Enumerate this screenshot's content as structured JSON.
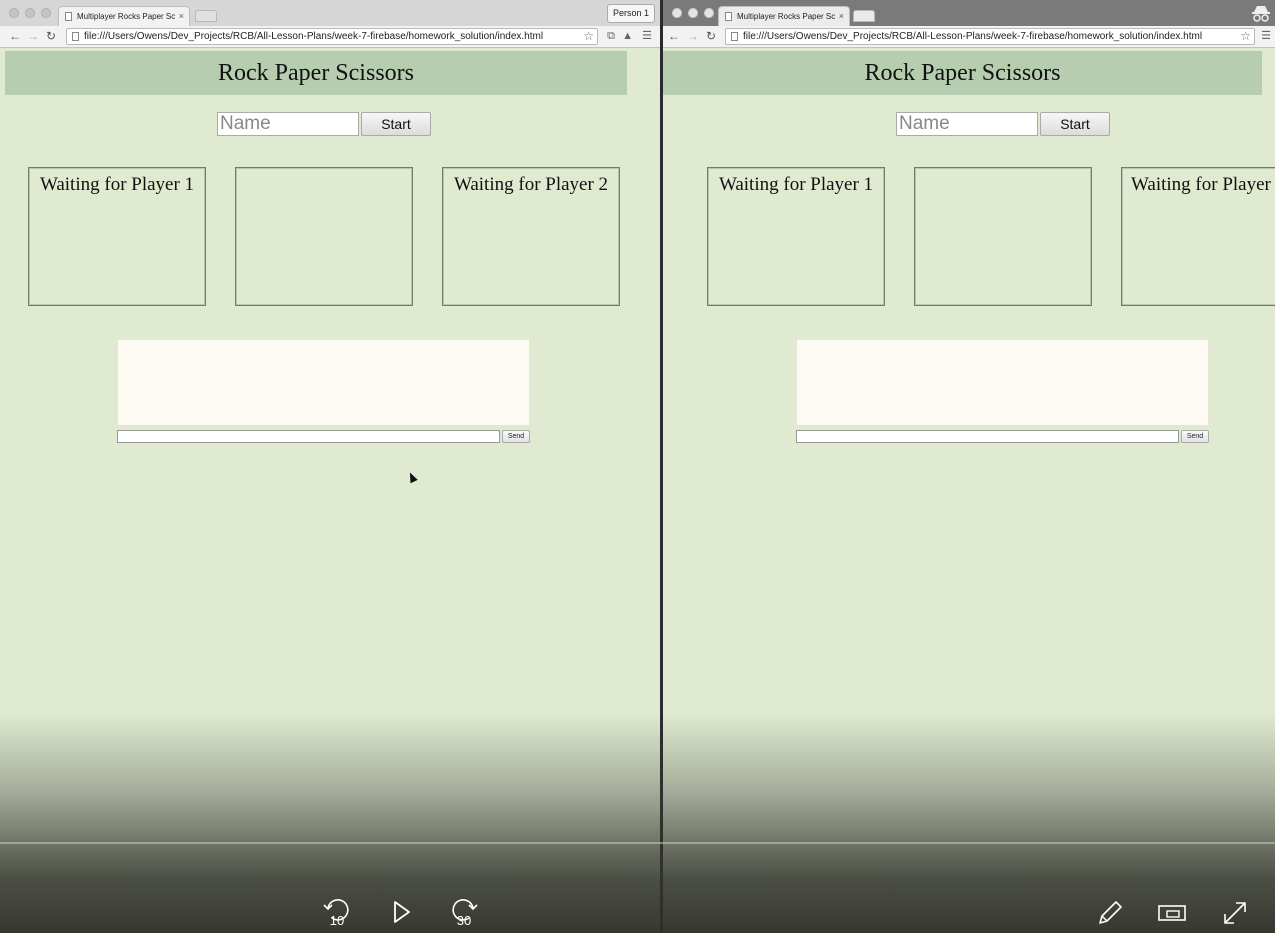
{
  "browser": {
    "tab_title": "Multiplayer Rocks Paper Sc",
    "tab_close": "×",
    "url": "file:///Users/Owens/Dev_Projects/RCB/All-Lesson-Plans/week-7-firebase/homework_solution/index.html",
    "profile_button": "Person 1"
  },
  "app": {
    "title": "Rock Paper Scissors",
    "name_placeholder": "Name",
    "start_label": "Start",
    "player1_status": "Waiting for Player 1",
    "player2_status": "Waiting for Player 2",
    "send_label": "Send"
  },
  "video_player": {
    "rewind_seconds": "10",
    "forward_seconds": "30"
  }
}
